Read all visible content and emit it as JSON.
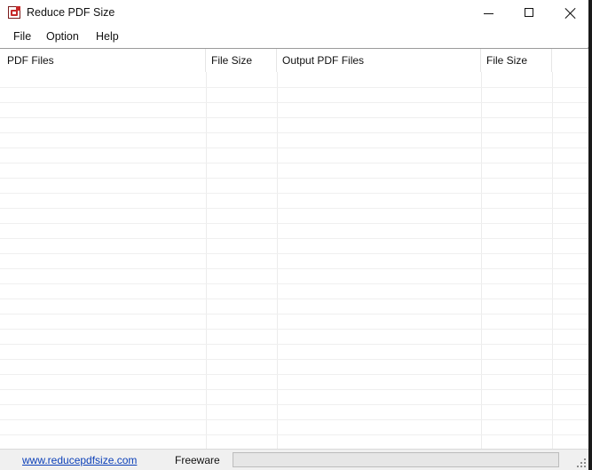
{
  "window": {
    "title": "Reduce PDF Size",
    "icon": "pdf-icon"
  },
  "menu": {
    "items": [
      "File",
      "Option",
      "Help"
    ]
  },
  "table": {
    "columns": [
      "PDF Files",
      "File Size",
      "Output PDF Files",
      "File Size"
    ],
    "rows": []
  },
  "status": {
    "website": "www.reducepdfsize.com",
    "license": "Freeware",
    "progress": 0
  },
  "colors": {
    "link": "#0b3fb8",
    "progress_fill": "#06b025"
  }
}
